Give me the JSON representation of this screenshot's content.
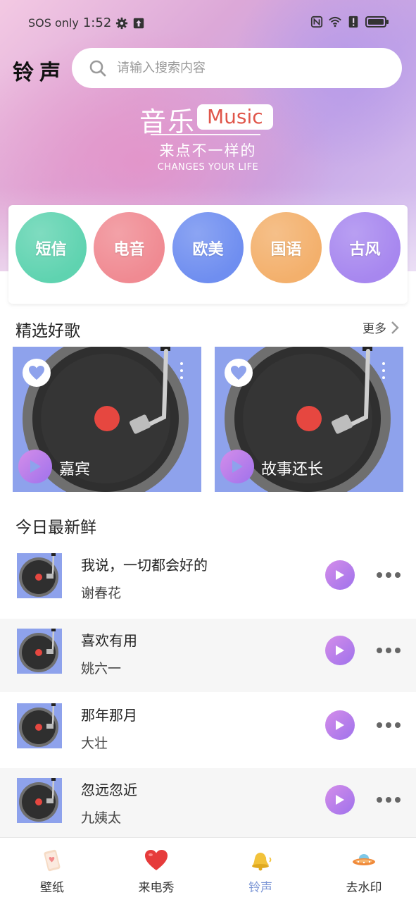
{
  "status_bar": {
    "carrier": "SOS only",
    "time": "1:52"
  },
  "header": {
    "title": "铃声",
    "search_placeholder": "请输入搜索内容"
  },
  "banner": {
    "main": "音乐",
    "tag": "Music",
    "subtitle": "来点不一样的",
    "english": "CHANGES YOUR LIFE"
  },
  "categories": [
    {
      "label": "短信",
      "color": "#5fd3b0"
    },
    {
      "label": "电音",
      "color": "#f08a92"
    },
    {
      "label": "欧美",
      "color": "#6f8ef0"
    },
    {
      "label": "国语",
      "color": "#f3b06c"
    },
    {
      "label": "古风",
      "color": "#a787ef"
    }
  ],
  "featured": {
    "heading": "精选好歌",
    "more_label": "更多",
    "items": [
      {
        "title": "嘉宾"
      },
      {
        "title": "故事还长"
      }
    ]
  },
  "latest": {
    "heading": "今日最新鲜",
    "songs": [
      {
        "title": "我说，一切都会好的",
        "artist": "谢春花"
      },
      {
        "title": "喜欢有用",
        "artist": "姚六一"
      },
      {
        "title": "那年那月",
        "artist": "大壮"
      },
      {
        "title": "忽远忽近",
        "artist": "九姨太"
      }
    ]
  },
  "tabs": [
    {
      "label": "壁纸",
      "icon": "wallpaper-icon",
      "active": false
    },
    {
      "label": "来电秀",
      "icon": "heart-icon",
      "active": false
    },
    {
      "label": "铃声",
      "icon": "bell-icon",
      "active": true
    },
    {
      "label": "去水印",
      "icon": "ufo-icon",
      "active": false
    }
  ],
  "colors": {
    "accent_play": "#b47ef0",
    "active_tab": "#7d97d6",
    "cover_bg": "#8ea2ec"
  }
}
